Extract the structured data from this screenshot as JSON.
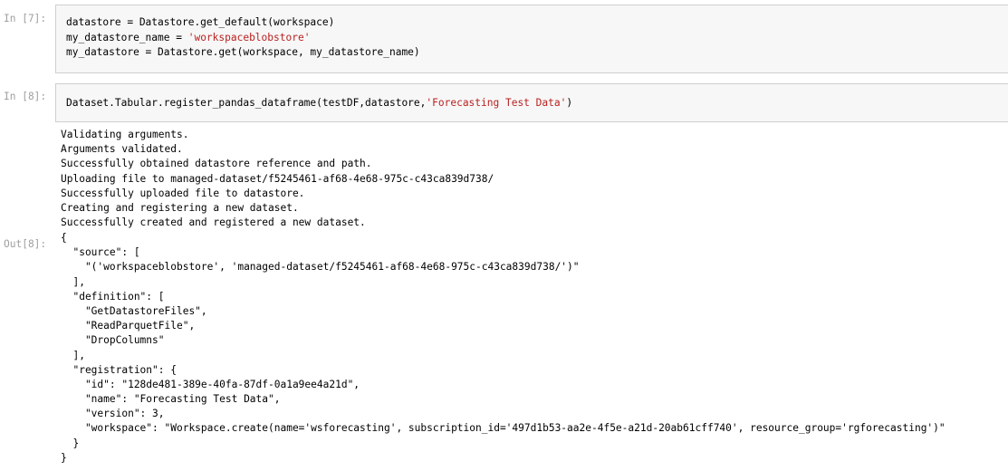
{
  "cell7": {
    "prompt": "In [7]:",
    "line1": "datastore = Datastore.get_default(workspace)",
    "line2_code": "my_datastore_name = ",
    "line2_str": "'workspaceblobstore'",
    "line3": "my_datastore = Datastore.get(workspace, my_datastore_name)"
  },
  "cell8": {
    "prompt": "In [8]:",
    "code_pre": "Dataset.Tabular.register_pandas_dataframe(testDF,datastore,",
    "code_str": "'Forecasting Test Data'",
    "code_post": ")",
    "stream_lines": [
      "Validating arguments.",
      "Arguments validated.",
      "Successfully obtained datastore reference and path.",
      "Uploading file to managed-dataset/f5245461-af68-4e68-975c-c43ca839d738/",
      "Successfully uploaded file to datastore.",
      "Creating and registering a new dataset.",
      "Successfully created and registered a new dataset."
    ],
    "out_prompt": "Out[8]:",
    "result_lines": [
      "{",
      "  \"source\": [",
      "    \"('workspaceblobstore', 'managed-dataset/f5245461-af68-4e68-975c-c43ca839d738/')\"",
      "  ],",
      "  \"definition\": [",
      "    \"GetDatastoreFiles\",",
      "    \"ReadParquetFile\",",
      "    \"DropColumns\"",
      "  ],",
      "  \"registration\": {",
      "    \"id\": \"128de481-389e-40fa-87df-0a1a9ee4a21d\",",
      "    \"name\": \"Forecasting Test Data\",",
      "    \"version\": 3,",
      "    \"workspace\": \"Workspace.create(name='wsforecasting', subscription_id='497d1b53-aa2e-4f5e-a21d-20ab61cff740', resource_group='rgforecasting')\"",
      "  }",
      "}"
    ]
  }
}
